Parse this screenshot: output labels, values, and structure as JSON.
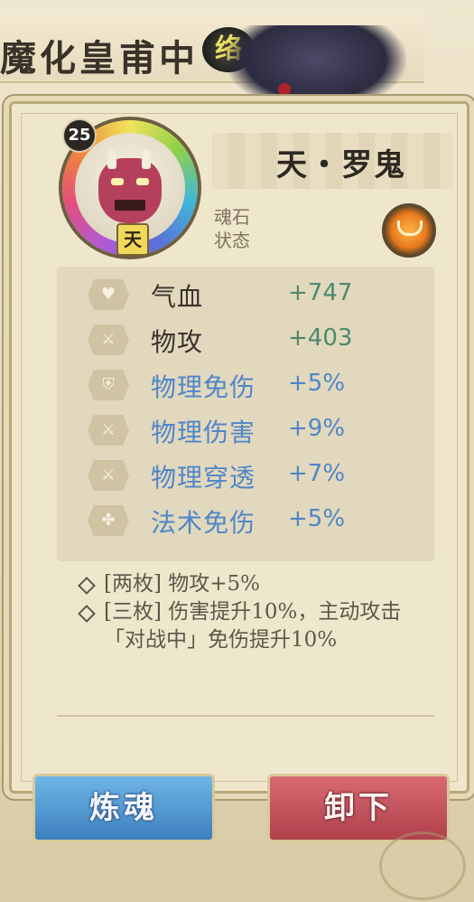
{
  "background": {
    "title": "魔化皇甫中",
    "badge": "络"
  },
  "card": {
    "name": "天・罗鬼",
    "level": "25",
    "tier": "天",
    "soul_label": "魂石\n状态"
  },
  "stats": [
    {
      "name": "气血",
      "value": "+747",
      "icon": "heart-icon",
      "color": "#4b8a6e"
    },
    {
      "name": "物攻",
      "value": "+403",
      "icon": "sword-icon",
      "color": "#4b8a6e"
    },
    {
      "name": "物理免伤",
      "value": "+5%",
      "icon": "shield-icon",
      "color": "#4f86c8"
    },
    {
      "name": "物理伤害",
      "value": "+9%",
      "icon": "sword-icon",
      "color": "#4f86c8"
    },
    {
      "name": "物理穿透",
      "value": "+7%",
      "icon": "sword-icon",
      "color": "#4f86c8"
    },
    {
      "name": "法术免伤",
      "value": "+5%",
      "icon": "magic-icon",
      "color": "#4f86c8"
    }
  ],
  "sets": [
    "[两枚] 物攻+5%",
    "[三枚] 伤害提升10%，主动攻击「对战中」免伤提升10%"
  ],
  "buttons": {
    "refine": "炼魂",
    "unequip": "卸下"
  }
}
